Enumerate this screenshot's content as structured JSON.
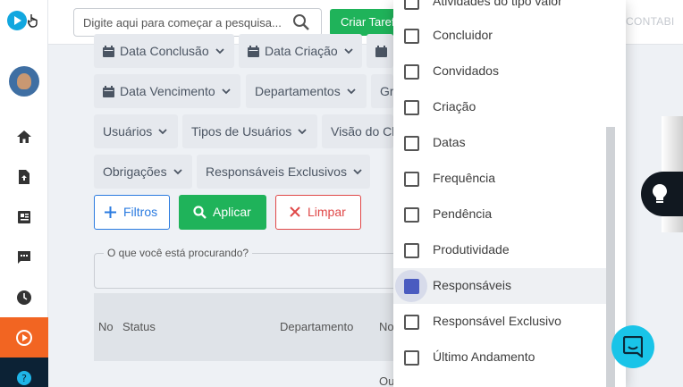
{
  "topbar": {
    "search_placeholder": "Digite aqui para começar a pesquisa...",
    "new_task_label": "Criar Tarefa",
    "company_text": "CONTABI"
  },
  "filters": {
    "chips": [
      "Data Conclusão",
      "Data Criação",
      "Data Vencimento",
      "Departamentos",
      "Gr",
      "Usuários",
      "Tipos de Usuários",
      "Visão do Cl",
      "Obrigações",
      "Responsáveis Exclusivos"
    ],
    "filtros_label": "Filtros",
    "aplicar_label": "Aplicar",
    "limpar_label": "Limpar",
    "search_label": "O que você está procurando?"
  },
  "table": {
    "columns": [
      "No",
      "Status",
      "Departamento",
      "No"
    ],
    "footer_fragment": "Ou"
  },
  "dropdown": {
    "items": [
      {
        "label": "Atividades do tipo valor",
        "checked": false
      },
      {
        "label": "Concluidor",
        "checked": false
      },
      {
        "label": "Convidados",
        "checked": false
      },
      {
        "label": "Criação",
        "checked": false
      },
      {
        "label": "Datas",
        "checked": false
      },
      {
        "label": "Frequência",
        "checked": false
      },
      {
        "label": "Pendência",
        "checked": false
      },
      {
        "label": "Produtividade",
        "checked": false
      },
      {
        "label": "Responsáveis",
        "checked": true
      },
      {
        "label": "Responsável Exclusivo",
        "checked": false
      },
      {
        "label": "Último Andamento",
        "checked": false
      }
    ]
  },
  "colors": {
    "accent_orange": "#f26522",
    "primary_green": "#1fb35a",
    "primary_blue": "#2b7be0",
    "danger_red": "#e04848",
    "chat_cyan": "#19c4e8",
    "checkbox_checked": "#4a5bc0"
  },
  "icons": [
    "play-logo-icon",
    "pointer-hand-icon",
    "home-icon",
    "upload-file-icon",
    "newspaper-icon",
    "comment-icon",
    "clock-icon",
    "play-circle-icon",
    "help-icon",
    "search-icon",
    "calendar-icon",
    "chevron-down-icon",
    "plus-icon",
    "close-icon",
    "lightbulb-icon",
    "chat-icon"
  ]
}
